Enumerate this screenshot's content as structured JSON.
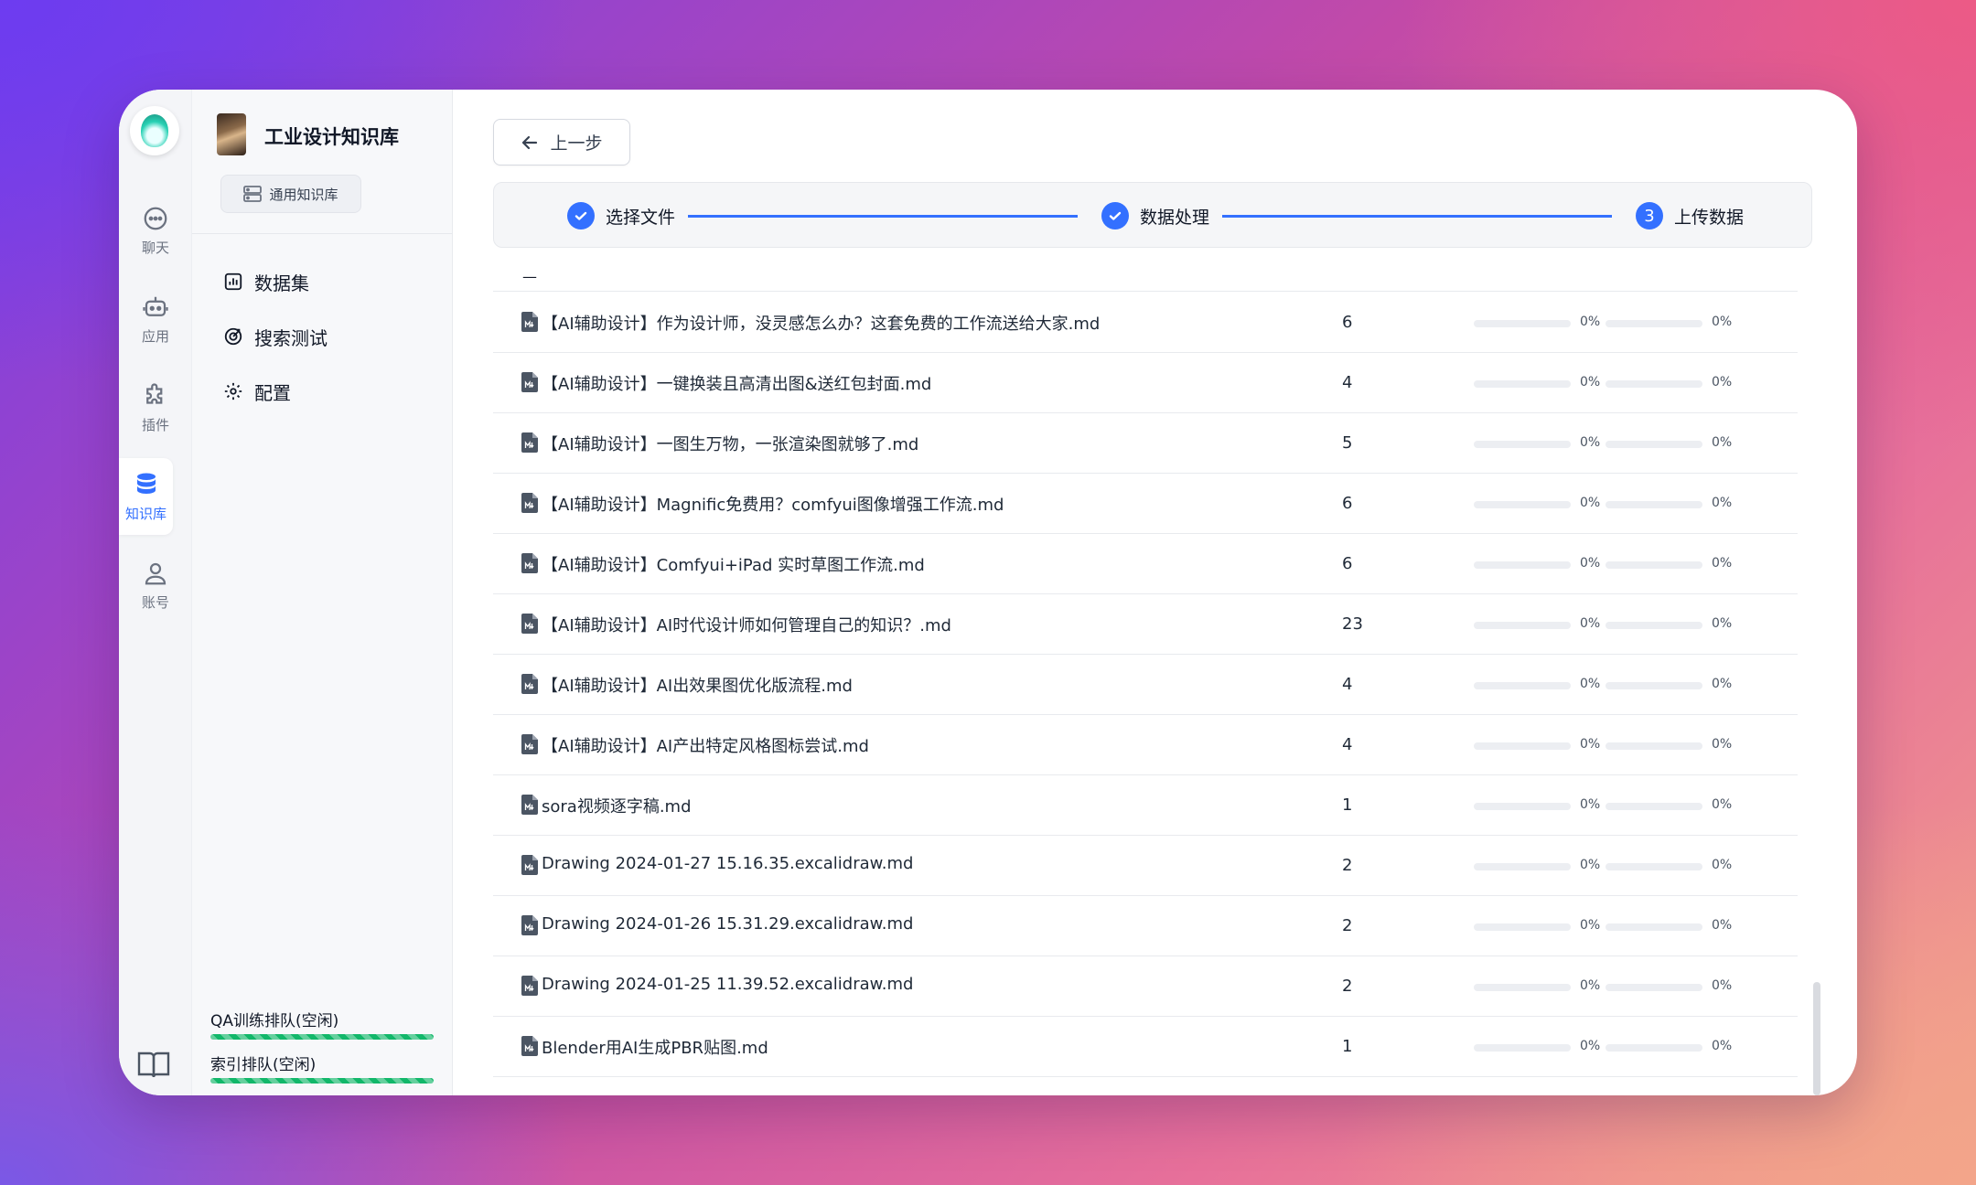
{
  "rail": {
    "items": [
      {
        "label": "聊天",
        "icon": "chat-icon"
      },
      {
        "label": "应用",
        "icon": "robot-icon"
      },
      {
        "label": "插件",
        "icon": "puzzle-icon"
      },
      {
        "label": "知识库",
        "icon": "database-icon",
        "active": true
      },
      {
        "label": "账号",
        "icon": "user-icon"
      }
    ]
  },
  "kb": {
    "title": "工业设计知识库",
    "tag": "通用知识库",
    "nav": [
      {
        "label": "数据集",
        "icon": "chart-icon"
      },
      {
        "label": "搜索测试",
        "icon": "target-icon"
      },
      {
        "label": "配置",
        "icon": "gear-icon"
      }
    ],
    "qa_queue": "QA训练排队(空闲)",
    "index_queue": "索引排队(空闲)"
  },
  "main": {
    "back_label": "上一步",
    "steps": [
      {
        "label": "选择文件",
        "done": true
      },
      {
        "label": "数据处理",
        "done": true
      },
      {
        "label": "上传数据",
        "number": "3"
      }
    ],
    "list_top_dash": "—",
    "accent": "#3370ff",
    "files": [
      {
        "name": "【AI辅助设计】作为设计师，没灵感怎么办？这套免费的工作流送给大家.md",
        "count": "6",
        "p1": "0%",
        "p2": "0%"
      },
      {
        "name": "【AI辅助设计】一键换装且高清出图&送红包封面.md",
        "count": "4",
        "p1": "0%",
        "p2": "0%"
      },
      {
        "name": "【AI辅助设计】一图生万物，一张渲染图就够了.md",
        "count": "5",
        "p1": "0%",
        "p2": "0%"
      },
      {
        "name": "【AI辅助设计】Magnific免费用？comfyui图像增强工作流.md",
        "count": "6",
        "p1": "0%",
        "p2": "0%"
      },
      {
        "name": "【AI辅助设计】Comfyui+iPad 实时草图工作流.md",
        "count": "6",
        "p1": "0%",
        "p2": "0%"
      },
      {
        "name": "【AI辅助设计】AI时代设计师如何管理自己的知识？.md",
        "count": "23",
        "p1": "0%",
        "p2": "0%"
      },
      {
        "name": "【AI辅助设计】AI出效果图优化版流程.md",
        "count": "4",
        "p1": "0%",
        "p2": "0%"
      },
      {
        "name": "【AI辅助设计】AI产出特定风格图标尝试.md",
        "count": "4",
        "p1": "0%",
        "p2": "0%"
      },
      {
        "name": "sora视频逐字稿.md",
        "count": "1",
        "p1": "0%",
        "p2": "0%"
      },
      {
        "name": "Drawing 2024-01-27 15.16.35.excalidraw.md",
        "count": "2",
        "p1": "0%",
        "p2": "0%"
      },
      {
        "name": "Drawing 2024-01-26 15.31.29.excalidraw.md",
        "count": "2",
        "p1": "0%",
        "p2": "0%"
      },
      {
        "name": "Drawing 2024-01-25 11.39.52.excalidraw.md",
        "count": "2",
        "p1": "0%",
        "p2": "0%"
      },
      {
        "name": "Blender用AI生成PBR贴图.md",
        "count": "1",
        "p1": "0%",
        "p2": "0%"
      }
    ]
  }
}
